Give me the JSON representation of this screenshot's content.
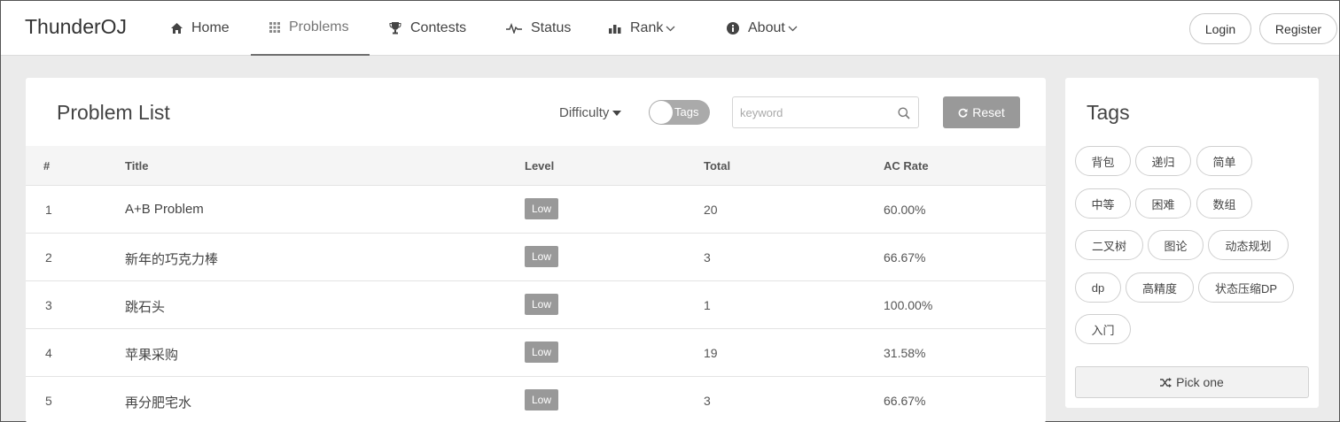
{
  "brand": "ThunderOJ",
  "nav": {
    "home": "Home",
    "problems": "Problems",
    "contests": "Contests",
    "status": "Status",
    "rank": "Rank",
    "about": "About"
  },
  "auth": {
    "login": "Login",
    "register": "Register"
  },
  "problem_list": {
    "title": "Problem List",
    "difficulty_label": "Difficulty",
    "tags_toggle_label": "Tags",
    "search_placeholder": "keyword",
    "reset_label": "Reset",
    "columns": [
      "#",
      "Title",
      "Level",
      "Total",
      "AC Rate"
    ],
    "rows": [
      {
        "id": "1",
        "title": "A+B Problem",
        "level": "Low",
        "total": "20",
        "ac_rate": "60.00%"
      },
      {
        "id": "2",
        "title": "新年的巧克力棒",
        "level": "Low",
        "total": "3",
        "ac_rate": "66.67%"
      },
      {
        "id": "3",
        "title": "跳石头",
        "level": "Low",
        "total": "1",
        "ac_rate": "100.00%"
      },
      {
        "id": "4",
        "title": "苹果采购",
        "level": "Low",
        "total": "19",
        "ac_rate": "31.58%"
      },
      {
        "id": "5",
        "title": "再分肥宅水",
        "level": "Low",
        "total": "3",
        "ac_rate": "66.67%"
      }
    ]
  },
  "tags_panel": {
    "title": "Tags",
    "tags": [
      "背包",
      "递归",
      "简单",
      "中等",
      "困难",
      "数组",
      "二叉树",
      "图论",
      "动态规划",
      "dp",
      "高精度",
      "状态压缩DP",
      "入门"
    ],
    "pick_one_label": "Pick one"
  },
  "colors": {
    "accent_gray": "#999999",
    "background": "#ebebeb",
    "active_underline": "#6e6e6e"
  },
  "icons": {
    "home": "home-icon",
    "problems": "grid-icon",
    "contests": "trophy-icon",
    "status": "pulse-icon",
    "rank": "bar-chart-icon",
    "about": "info-icon",
    "search": "search-icon",
    "reset": "refresh-icon",
    "pick": "shuffle-icon"
  }
}
